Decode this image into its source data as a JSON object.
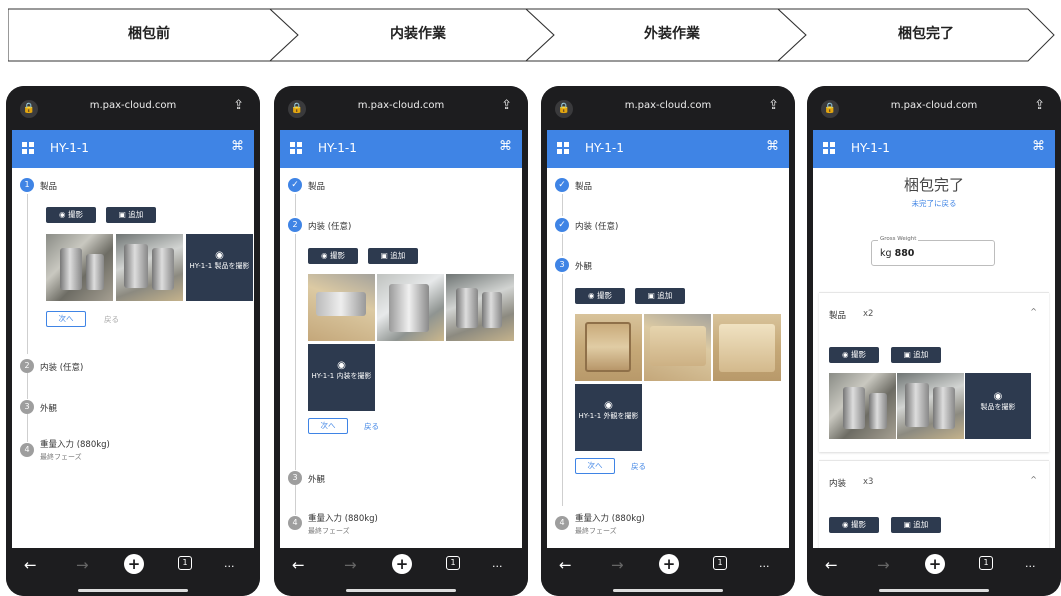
{
  "flow": {
    "steps": [
      "梱包前",
      "内装作業",
      "外装作業",
      "梱包完了"
    ]
  },
  "browser": {
    "url": "m.pax-cloud.com",
    "lock_icon": "🔒",
    "share_icon": "⇪",
    "back_icon": "←",
    "forward_icon": "→",
    "plus_icon": "+",
    "tab_count": "1",
    "more_icon": "···"
  },
  "app": {
    "code": "HY-1-1",
    "menu_icon": "grid-icon",
    "scan_icon": "⌘"
  },
  "buttons": {
    "photo": "撮影",
    "add": "追加",
    "next": "次へ",
    "back": "戻る",
    "camera_glyph": "◉",
    "add_glyph": "▣"
  },
  "steps": {
    "product": "製品",
    "inner": "内装 (任意)",
    "outer": "外観",
    "weight": "重量入力 (880kg)",
    "weight_sub": "最終フェーズ",
    "n1": "1",
    "n2": "2",
    "n3": "3",
    "n4": "4",
    "check": "✓"
  },
  "captions": {
    "product": "HY-1-1 製品を撮影",
    "inner": "HY-1-1 内装を撮影",
    "outer": "HY-1-1 外観を撮影",
    "product_short": "製品を撮影"
  },
  "done": {
    "title": "梱包完了",
    "link": "未完了に戻る",
    "gw_label": "Gross Weight",
    "gw_unit": "kg",
    "gw_value": "880",
    "sections": [
      {
        "title": "製品",
        "count": "x2"
      },
      {
        "title": "内装",
        "count": "x3"
      }
    ],
    "chevron": "^"
  }
}
